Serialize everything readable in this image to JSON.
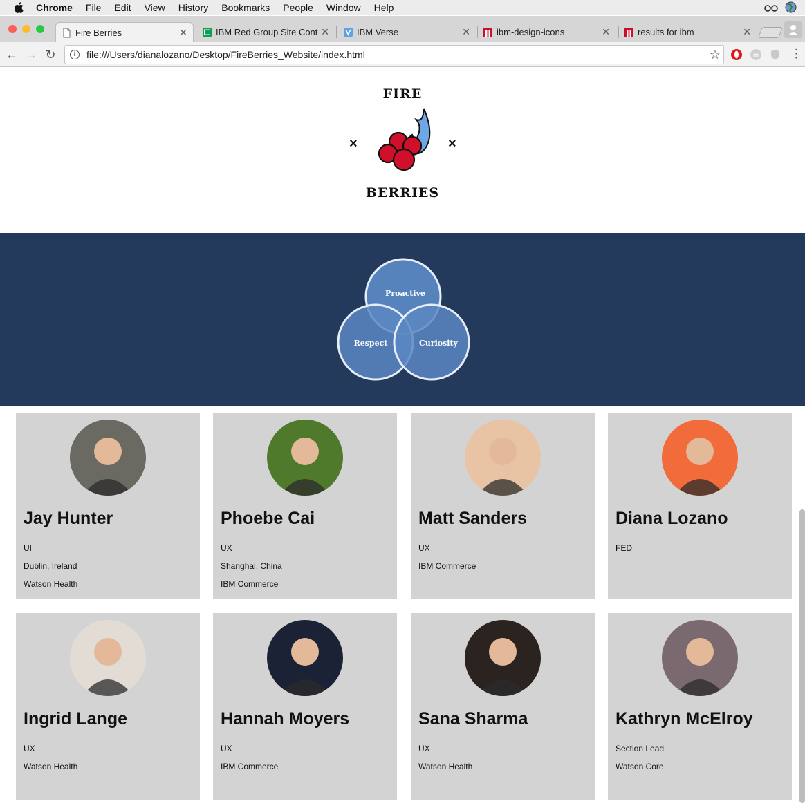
{
  "menubar": {
    "items": [
      "Chrome",
      "File",
      "Edit",
      "View",
      "History",
      "Bookmarks",
      "People",
      "Window",
      "Help"
    ]
  },
  "tabs": [
    {
      "label": "Fire Berries",
      "icon": "page-icon"
    },
    {
      "label": "IBM Red Group Site Conte",
      "icon": "sheets-icon"
    },
    {
      "label": "IBM Verse",
      "icon": "verse-icon"
    },
    {
      "label": "ibm-design-icons",
      "icon": "ibm-red-icon"
    },
    {
      "label": "results for ibm",
      "icon": "ibm-red-icon"
    }
  ],
  "toolbar": {
    "url": "file:///Users/dianalozano/Desktop/FireBerries_Website/index.html"
  },
  "logo": {
    "top": "FIRE",
    "bottom": "BERRIES",
    "cross": "×"
  },
  "values": {
    "circles": [
      "Proactive",
      "Respect",
      "Curiosity"
    ],
    "colors": {
      "band": "#233a5d",
      "circle": "#5b87c2",
      "stroke": "#e8eef8"
    }
  },
  "team": [
    {
      "name": "Jay Hunter",
      "details": [
        "UI",
        "Dublin, Ireland",
        "Watson Health"
      ],
      "avatar": "#6b6a62"
    },
    {
      "name": "Phoebe Cai",
      "details": [
        "UX",
        "Shanghai, China",
        "IBM Commerce"
      ],
      "avatar": "#4f7a2c"
    },
    {
      "name": "Matt Sanders",
      "details": [
        "UX",
        "IBM Commerce"
      ],
      "avatar": "#e8c3a4"
    },
    {
      "name": "Diana Lozano",
      "details": [
        "FED"
      ],
      "avatar": "#f26b3a"
    },
    {
      "name": "Ingrid Lange",
      "details": [
        "UX",
        "Watson Health"
      ],
      "avatar": "#e2dcd4"
    },
    {
      "name": "Hannah Moyers",
      "details": [
        "UX",
        "IBM Commerce"
      ],
      "avatar": "#1c2236"
    },
    {
      "name": "Sana Sharma",
      "details": [
        "UX",
        "Watson Health"
      ],
      "avatar": "#2a2320"
    },
    {
      "name": "Kathryn McElroy",
      "details": [
        "Section Lead",
        "Watson Core"
      ],
      "avatar": "#7a6a70"
    }
  ]
}
